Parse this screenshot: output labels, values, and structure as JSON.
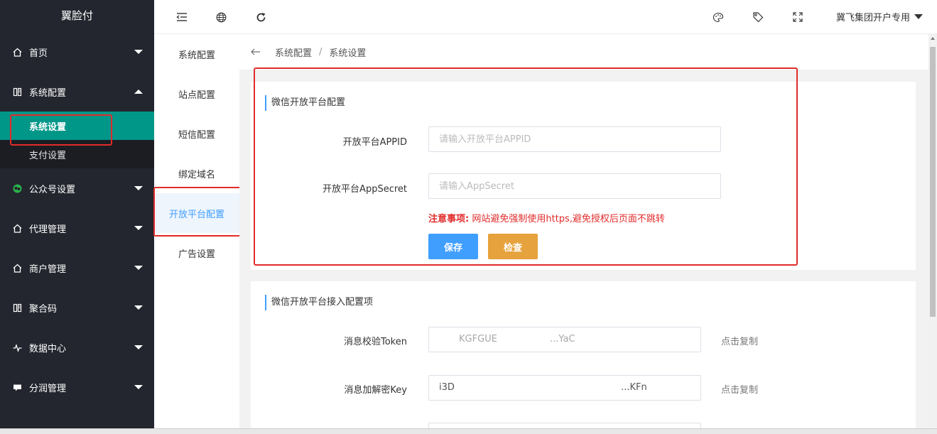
{
  "sidebar": {
    "logo": "翼脸付",
    "menus": [
      {
        "label": "首页",
        "icon": "home-icon"
      },
      {
        "label": "系统配置",
        "icon": "book-icon",
        "expanded": true,
        "children": [
          {
            "label": "系统设置",
            "active": true
          },
          {
            "label": "支付设置"
          }
        ]
      },
      {
        "label": "公众号设置",
        "icon": "wechat-icon"
      },
      {
        "label": "代理管理",
        "icon": "home-icon"
      },
      {
        "label": "商户管理",
        "icon": "home-icon"
      },
      {
        "label": "聚合码",
        "icon": "book-icon"
      },
      {
        "label": "数据中心",
        "icon": "pulse-icon"
      },
      {
        "label": "分润管理",
        "icon": "chat-icon"
      }
    ]
  },
  "topbar": {
    "user": "冀飞集团开户专用"
  },
  "subnav": {
    "items": [
      "系统配置",
      "站点配置",
      "短信配置",
      "绑定域名",
      "开放平台配置",
      "广告设置"
    ],
    "active": "开放平台配置"
  },
  "breadcrumb": {
    "parent": "系统配置",
    "current": "系统设置",
    "separator": "/"
  },
  "open_platform": {
    "title": "微信开放平台配置",
    "appid_label": "开放平台APPID",
    "appid_placeholder": "请输入开放平台APPID",
    "secret_label": "开放平台AppSecret",
    "secret_placeholder": "请输入AppSecret",
    "notice_prefix": "注意事项:",
    "notice_text": "网站避免强制使用https,避免授权后页面不跳转",
    "save_label": "保存",
    "check_label": "检查"
  },
  "access_config": {
    "title": "微信开放平台接入配置项",
    "token_label": "消息校验Token",
    "token_value_start": "KGFGUE",
    "token_value_end": "...YaC",
    "key_label": "消息加解密Key",
    "key_value_start": "i3D",
    "key_value_end": "...KFn",
    "copy_label": "点击复制"
  },
  "colors": {
    "sidebar_bg": "#23262e",
    "active_green": "#009688",
    "highlight_red": "#e12b2b",
    "primary_blue": "#409eff",
    "warning_orange": "#e6a23c"
  }
}
